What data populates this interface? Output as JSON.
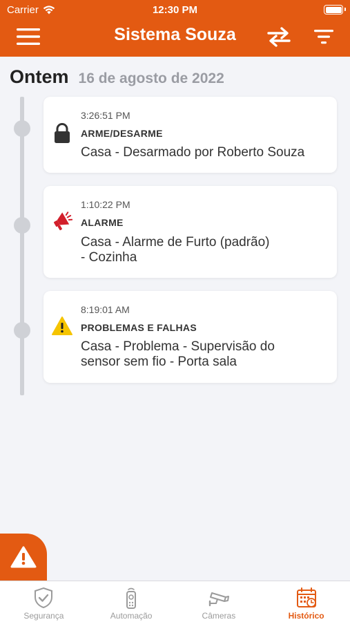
{
  "status_bar": {
    "carrier": "Carrier",
    "time": "12:30 PM"
  },
  "header": {
    "title": "Sistema Souza"
  },
  "date": {
    "day": "Ontem",
    "full": "16 de agosto de 2022"
  },
  "events": [
    {
      "time": "3:26:51 PM",
      "category": "ARME/DESARME",
      "description": "Casa - Desarmado por Roberto Souza",
      "icon": "lock-icon"
    },
    {
      "time": "1:10:22 PM",
      "category": "ALARME",
      "description_lines": [
        "Casa - Alarme de Furto (padrão)",
        "- Cozinha"
      ],
      "icon": "alarm-megaphone-icon"
    },
    {
      "time": "8:19:01 AM",
      "category": "PROBLEMAS E FALHAS",
      "description_lines": [
        "Casa - Problema - Supervisão do",
        "sensor sem fio -  Porta sala"
      ],
      "icon": "warning-icon"
    }
  ],
  "tabs": [
    {
      "label": "Segurança",
      "icon": "shield-check-icon",
      "active": false
    },
    {
      "label": "Automação",
      "icon": "remote-control-icon",
      "active": false
    },
    {
      "label": "Câmeras",
      "icon": "camera-icon",
      "active": false
    },
    {
      "label": "Histórico",
      "icon": "calendar-history-icon",
      "active": true
    }
  ],
  "colors": {
    "brand": "#e35a12",
    "alarm": "#d21f2b",
    "warning": "#f5c400",
    "background": "#f3f4f8"
  }
}
